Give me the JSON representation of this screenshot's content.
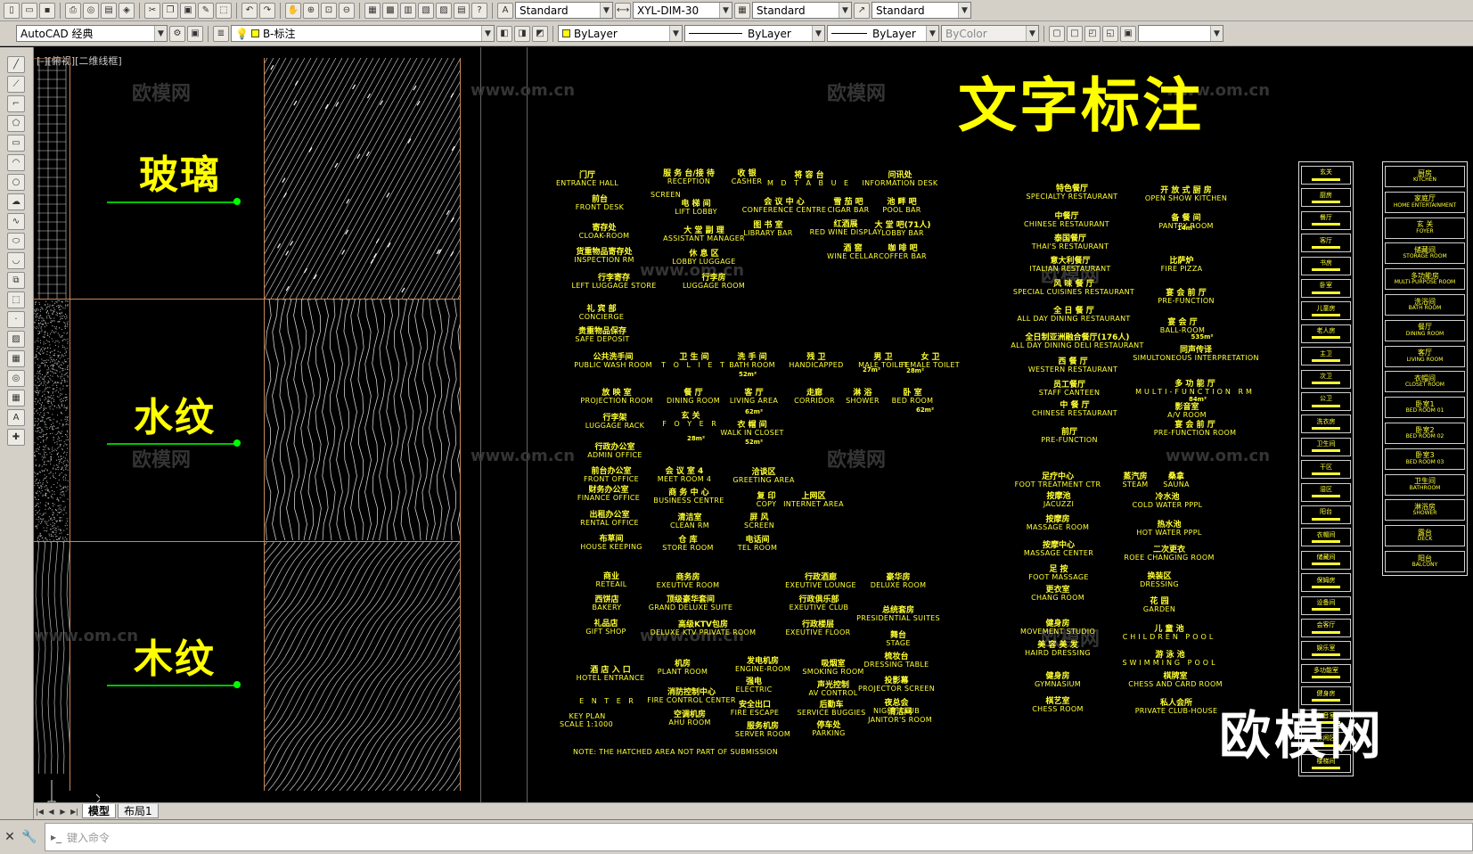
{
  "toolbar1": {
    "text_style": "Standard",
    "dim_style": "XYL-DIM-30",
    "table_style": "Standard",
    "mleader_style": "Standard"
  },
  "toolbar2": {
    "workspace": "AutoCAD 经典",
    "layer": "B-标注",
    "color": "ByLayer",
    "linetype": "ByLayer",
    "lineweight": "ByLayer",
    "plotstyle": "ByColor"
  },
  "viewport": {
    "label": "[-][俯视][二维线框]"
  },
  "samples": [
    {
      "label": "玻璃"
    },
    {
      "label": "水纹"
    },
    {
      "label": "木纹"
    }
  ],
  "title": "文字标注",
  "watermark": {
    "small_cn": "欧模网",
    "small_url": "www.om.cn",
    "big": "欧模网"
  },
  "annotations_a": [
    {
      "zh": "门厅",
      "en": "ENTRANCE HALL"
    },
    {
      "zh": "服 务 台/接 待",
      "en": "RECEPTION"
    },
    {
      "zh": "收 银",
      "en": "CASHER"
    },
    {
      "zh": "将 容 台",
      "en": "M D T A B U E"
    },
    {
      "zh": "问讯处",
      "en": "INFORMATION DESK"
    },
    {
      "zh": "前台",
      "en": "FRONT DESK"
    },
    {
      "zh": "电 梯 间",
      "en": "LIFT LOBBY"
    },
    {
      "zh": "会 议 中 心",
      "en": "CONFERENCE CENTRE"
    },
    {
      "zh": "雪 茄 吧",
      "en": "CIGAR BAR"
    },
    {
      "zh": "池 畔 吧",
      "en": "POOL BAR"
    },
    {
      "zh": "寄存处",
      "en": "CLOAK-ROOM"
    },
    {
      "zh": "大 堂 副 理",
      "en": "ASSISTANT MANAGER"
    },
    {
      "zh": "图 书 室",
      "en": "LIBRARY BAR"
    },
    {
      "zh": "红酒展",
      "en": "RED WINE DISPLAY"
    },
    {
      "zh": "大 堂 吧(71人)",
      "en": "LOBBY BAR"
    },
    {
      "zh": "货重物品寄存处",
      "en": "INSPECTION RM"
    },
    {
      "zh": "休 息 区",
      "en": "LOBBY LUGGAGE"
    },
    {
      "zh": "酒 窖",
      "en": "WINE CELLAR"
    },
    {
      "zh": "咖 啡 吧",
      "en": "COFFER BAR"
    },
    {
      "zh": "行李寄存",
      "en": "LEFT LUGGAGE STORE"
    },
    {
      "zh": "行李房",
      "en": "LUGGAGE ROOM"
    },
    {
      "zh": "礼 宾 部",
      "en": "CONCIERGE"
    },
    {
      "zh": "贵重物品保存",
      "en": "SAFE DEPOSIT"
    },
    {
      "zh": "公共洗手间",
      "en": "PUBLIC WASH ROOM"
    },
    {
      "zh": "卫 生 间",
      "en": "T O L I E T"
    },
    {
      "zh": "洗 手 间",
      "en": "BATH ROOM"
    },
    {
      "zh": "残 卫",
      "en": "HANDICAPPED"
    },
    {
      "zh": "男 卫",
      "en": "MALE TOILET"
    },
    {
      "zh": "女 卫",
      "en": "FEMALE TOILET"
    },
    {
      "zh": "放 映 室",
      "en": "PROJECTION ROOM"
    },
    {
      "zh": "餐 厅",
      "en": "DINING ROOM"
    },
    {
      "zh": "客 厅",
      "en": "LIVING AREA"
    },
    {
      "zh": "走廊",
      "en": "CORRIDOR"
    },
    {
      "zh": "淋 浴",
      "en": "SHOWER"
    },
    {
      "zh": "卧 室",
      "en": "BED ROOM"
    },
    {
      "zh": "行李架",
      "en": "LUGGAGE RACK"
    },
    {
      "zh": "玄 关",
      "en": "F O Y E R"
    },
    {
      "zh": "衣 帽 间",
      "en": "WALK IN CLOSET"
    },
    {
      "zh": "行政办公室",
      "en": "ADMIN OFFICE"
    },
    {
      "zh": "前台办公室",
      "en": "FRONT OFFICE"
    },
    {
      "zh": "会 议 室 4",
      "en": "MEET ROOM 4"
    },
    {
      "zh": "洽谈区",
      "en": "GREETING AREA"
    },
    {
      "zh": "财务办公室",
      "en": "FINANCE OFFICE"
    },
    {
      "zh": "商 务 中 心",
      "en": "BUSINESS CENTRE"
    },
    {
      "zh": "复 印",
      "en": "COPY"
    },
    {
      "zh": "上网区",
      "en": "INTERNET AREA"
    },
    {
      "zh": "出租办公室",
      "en": "RENTAL OFFICE"
    },
    {
      "zh": "清洁室",
      "en": "CLEAN RM"
    },
    {
      "zh": "屏 风",
      "en": "SCREEN"
    },
    {
      "zh": "布草间",
      "en": "HOUSE KEEPING"
    },
    {
      "zh": "仓 库",
      "en": "STORE ROOM"
    },
    {
      "zh": "电话间",
      "en": "TEL ROOM"
    },
    {
      "zh": "商业",
      "en": "RETEAIL"
    },
    {
      "zh": "商务房",
      "en": "EXEUTIVE ROOM"
    },
    {
      "zh": "行政酒廊",
      "en": "EXEUTIVE LOUNGE"
    },
    {
      "zh": "豪华房",
      "en": "DELUXE ROOM"
    },
    {
      "zh": "西饼店",
      "en": "BAKERY"
    },
    {
      "zh": "顶级豪华套间",
      "en": "GRAND DELUXE SUITE"
    },
    {
      "zh": "行政俱乐部",
      "en": "EXEUTIVE CLUB"
    },
    {
      "zh": "总统套房",
      "en": "PRESIDENTIAL SUITES"
    },
    {
      "zh": "礼品店",
      "en": "GIFT SHOP"
    },
    {
      "zh": "高级KTV包房",
      "en": "DELUXE KTV PRIVATE ROOM"
    },
    {
      "zh": "行政楼层",
      "en": "EXEUTIVE FLOOR"
    },
    {
      "zh": "舞台",
      "en": "STAGE"
    },
    {
      "zh": "机房",
      "en": "PLANT ROOM"
    },
    {
      "zh": "发电机房",
      "en": "ENGINE-ROOM"
    },
    {
      "zh": "吸烟室",
      "en": "SMOKING ROOM"
    },
    {
      "zh": "梳妆台",
      "en": "DRESSING TABLE"
    },
    {
      "zh": "酒 店 入 口",
      "en": "HOTEL ENTRANCE"
    },
    {
      "zh": "强电",
      "en": "ELECTRIC"
    },
    {
      "zh": "声光控制",
      "en": "AV CONTROL"
    },
    {
      "zh": "投影幕",
      "en": "PROJECTOR SCREEN"
    },
    {
      "zh": "",
      "en": "E N T E R"
    },
    {
      "zh": "消防控制中心",
      "en": "FIRE CONTROL CENTER"
    },
    {
      "zh": "安全出口",
      "en": "FIRE ESCAPE"
    },
    {
      "zh": "后勤车",
      "en": "SERVICE BUGGIES"
    },
    {
      "zh": "夜总会",
      "en": "NIGHT CLUB"
    },
    {
      "zh": "",
      "en": "KEY PLAN"
    },
    {
      "zh": "",
      "en": "SCALE 1:1000"
    },
    {
      "zh": "空调机房",
      "en": "AHU ROOM"
    },
    {
      "zh": "服务机房",
      "en": "SERVER ROOM"
    },
    {
      "zh": "停车处",
      "en": "PARKING"
    },
    {
      "zh": "清洁间",
      "en": "JANITOR'S ROOM"
    },
    {
      "zh": "",
      "en": "NOTE: THE HATCHED AREA NOT PART OF SUBMISSION"
    },
    {
      "zh": "",
      "en": "SCREEN"
    }
  ],
  "annotations_b": [
    {
      "zh": "特色餐厅",
      "en": "SPECIALTY RESTAURANT"
    },
    {
      "zh": "开 放 式 厨 房",
      "en": "OPEN SHOW KITCHEN"
    },
    {
      "zh": "中餐厅",
      "en": "CHINESE RESTAURANT"
    },
    {
      "zh": "备 餐 间",
      "en": "PANTRY ROOM"
    },
    {
      "zh": "泰国餐厅",
      "en": "THAI'S RESTAURANT"
    },
    {
      "zh": "意大利餐厅",
      "en": "ITALIAN RESTAURANT"
    },
    {
      "zh": "比萨炉",
      "en": "FIRE PIZZA"
    },
    {
      "zh": "风 味 餐 厅",
      "en": "SPECIAL CUISINES RESTAURANT"
    },
    {
      "zh": "宴 会 前 厅",
      "en": "PRE-FUNCTION"
    },
    {
      "zh": "全 日 餐 厅",
      "en": "ALL DAY DINING RESTAURANT"
    },
    {
      "zh": "宴 会 厅",
      "en": "BALL-ROOM"
    },
    {
      "zh": "全日制亚洲融合餐厅(176人)",
      "en": "ALL DAY DINING DELI RESTAURANT"
    },
    {
      "zh": "同声传译",
      "en": "SIMULTONEOUS INTERPRETATION"
    },
    {
      "zh": "西 餐 厅",
      "en": "WESTERN RESTAURANT"
    },
    {
      "zh": "员工餐厅",
      "en": "STAFF CANTEEN"
    },
    {
      "zh": "多 功 能 厅",
      "en": "MULTI-FUNCTION RM"
    },
    {
      "zh": "中 餐 厅",
      "en": "CHINESE RESTAURANT"
    },
    {
      "zh": "影音室",
      "en": "A/V ROOM"
    },
    {
      "zh": "前厅",
      "en": "PRE-FUNCTION"
    },
    {
      "zh": "宴 会 前 厅",
      "en": "PRE-FUNCTION ROOM"
    },
    {
      "zh": "足疗中心",
      "en": "FOOT TREATMENT CTR"
    },
    {
      "zh": "蒸汽房",
      "en": "STEAM"
    },
    {
      "zh": "桑拿",
      "en": "SAUNA"
    },
    {
      "zh": "按摩池",
      "en": "JACUZZI"
    },
    {
      "zh": "冷水池",
      "en": "COLD WATER PPPL"
    },
    {
      "zh": "按摩房",
      "en": "MASSAGE ROOM"
    },
    {
      "zh": "热水池",
      "en": "HOT WATER PPPL"
    },
    {
      "zh": "按摩中心",
      "en": "MASSAGE CENTER"
    },
    {
      "zh": "二次更衣",
      "en": "ROEE CHANGING ROOM"
    },
    {
      "zh": "足 按",
      "en": "FOOT MASSAGE"
    },
    {
      "zh": "更衣室",
      "en": "CHANG ROOM"
    },
    {
      "zh": "换装区",
      "en": "DRESSING"
    },
    {
      "zh": "花 园",
      "en": "GARDEN"
    },
    {
      "zh": "健身房",
      "en": "MOVEMENT STUDIO"
    },
    {
      "zh": "儿 童 池",
      "en": "CHILDREN POOL"
    },
    {
      "zh": "美 容 美 发",
      "en": "HAIRD DRESSING"
    },
    {
      "zh": "游 泳 池",
      "en": "SWIMMING POOL"
    },
    {
      "zh": "健身房",
      "en": "GYMNASIUM"
    },
    {
      "zh": "棋牌室",
      "en": "CHESS AND CARD ROOM"
    },
    {
      "zh": "棋艺室",
      "en": "CHESS ROOM"
    },
    {
      "zh": "私人会所",
      "en": "PRIVATE CLUB-HOUSE"
    }
  ],
  "area_texts": [
    "52m²",
    "27m²",
    "28m²",
    "62m²",
    "62m²",
    "28m²",
    "52m²",
    "14m²",
    "535m²",
    "84m²"
  ],
  "legend_col1": [
    "玄关",
    "厨房",
    "餐厅",
    "客厅",
    "书房",
    "卧室",
    "儿童房",
    "老人房",
    "主卫",
    "次卫",
    "公卫",
    "洗衣房",
    "卫生间",
    "干区",
    "湿区",
    "阳台",
    "衣帽间",
    "储藏间",
    "保姆房",
    "设备间",
    "会客厅",
    "娱乐室",
    "多功能室",
    "健身房",
    "影音室",
    "休闲区",
    "楼梯间"
  ],
  "legend_col2": [
    {
      "zh": "厨房",
      "en": "KITCHEN"
    },
    {
      "zh": "家庭厅",
      "en": "HOME ENTERTAINMENT"
    },
    {
      "zh": "玄 关",
      "en": "FOYER"
    },
    {
      "zh": "储藏间",
      "en": "STORAGE ROOM"
    },
    {
      "zh": "多功能房",
      "en": "MULTI-PURPOSE ROOM"
    },
    {
      "zh": "洗浴间",
      "en": "BATH ROOM"
    },
    {
      "zh": "餐厅",
      "en": "DINING ROOM"
    },
    {
      "zh": "客厅",
      "en": "LIVING ROOM"
    },
    {
      "zh": "衣帽间",
      "en": "CLOSET ROOM"
    },
    {
      "zh": "卧室1",
      "en": "BED ROOM 01"
    },
    {
      "zh": "卧室2",
      "en": "BED ROOM 02"
    },
    {
      "zh": "卧室3",
      "en": "BED ROOM 03"
    },
    {
      "zh": "卫生间",
      "en": "BATHROOM"
    },
    {
      "zh": "淋浴房",
      "en": "SHOWER"
    },
    {
      "zh": "露台",
      "en": "DECK"
    },
    {
      "zh": "阳台",
      "en": "BALCONY"
    }
  ],
  "tabs": {
    "model": "模型",
    "layout": "布局1"
  },
  "command": {
    "placeholder": "键入命令"
  }
}
